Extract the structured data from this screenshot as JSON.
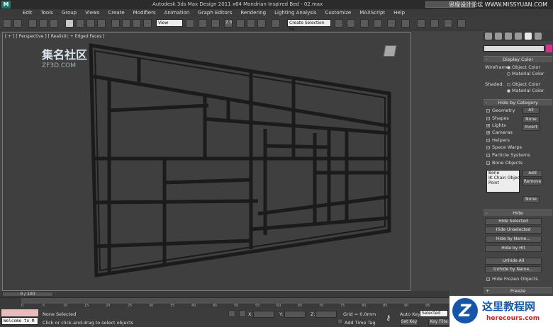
{
  "window": {
    "title": "Autodesk 3ds Max Design 2011 x64      Mondrian Inspired Bed - 02.max",
    "watermark_top": "思缘设计论坛 WWW.MISSYUAN.COM"
  },
  "menu": [
    "Edit",
    "Tools",
    "Group",
    "Views",
    "Create",
    "Modifiers",
    "Animation",
    "Graph Editors",
    "Rendering",
    "Lighting Analysis",
    "Customize",
    "MAXScript",
    "Help"
  ],
  "toolbar": {
    "view_dropdown": "View",
    "selection_set_dropdown": "Create Selection Se",
    "snap_value": "2.5"
  },
  "viewport": {
    "label": "[ + ] [ Perspective ] [ Realistic + Edged Faces ]",
    "watermark_cn": "集名社区",
    "watermark_site": "ZF3D.COM"
  },
  "command_panel": {
    "display_color": {
      "title": "Display Color",
      "wireframe_label": "Wireframe:",
      "shaded_label": "Shaded:",
      "opt_object": "Object Color",
      "opt_material": "Material Color"
    },
    "hide_by_category": {
      "title": "Hide by Category",
      "items": [
        {
          "label": "Geometry",
          "checked": false
        },
        {
          "label": "Shapes",
          "checked": false
        },
        {
          "label": "Lights",
          "checked": true
        },
        {
          "label": "Cameras",
          "checked": true
        },
        {
          "label": "Helpers",
          "checked": false
        },
        {
          "label": "Space Warps",
          "checked": false
        },
        {
          "label": "Particle Systems",
          "checked": false
        },
        {
          "label": "Bone Objects",
          "checked": false
        }
      ],
      "btn_all": "All",
      "btn_none": "None",
      "btn_invert": "Invert",
      "list": [
        "Bone",
        "IK Chain Object",
        "Point"
      ],
      "btn_add": "Add",
      "btn_remove": "Remove",
      "btn_none2": "None"
    },
    "hide": {
      "title": "Hide",
      "buttons": [
        "Hide Selected",
        "Hide Unselected",
        "Hide by Name...",
        "Hide by Hit",
        "Unhide All",
        "Unhide by Name..."
      ],
      "frozen_label": "Hide Frozen Objects"
    },
    "freeze": {
      "title": "Freeze"
    }
  },
  "timeline": {
    "slider_label": "0 / 100",
    "ticks": [
      "0",
      "5",
      "10",
      "15",
      "20",
      "25",
      "30",
      "35",
      "40",
      "45",
      "50",
      "55",
      "60",
      "65",
      "70",
      "75",
      "80",
      "85",
      "90",
      "95"
    ]
  },
  "status": {
    "maxscript": "Welcome to M",
    "selection": "None Selected",
    "prompt": "Click or click-and-drag to select objects",
    "x_label": "X:",
    "y_label": "Y:",
    "z_label": "Z:",
    "grid": "Grid = 0.0mm",
    "add_time_tag": "Add Time Tag",
    "auto_key": "Auto Key",
    "set_key": "Set Key",
    "selected_dropdown": "Selected",
    "key_filters": "Key Filte"
  },
  "watermark_br": {
    "logo_letter": "Z",
    "cn": "这里教程网",
    "url": "herecours.com"
  }
}
